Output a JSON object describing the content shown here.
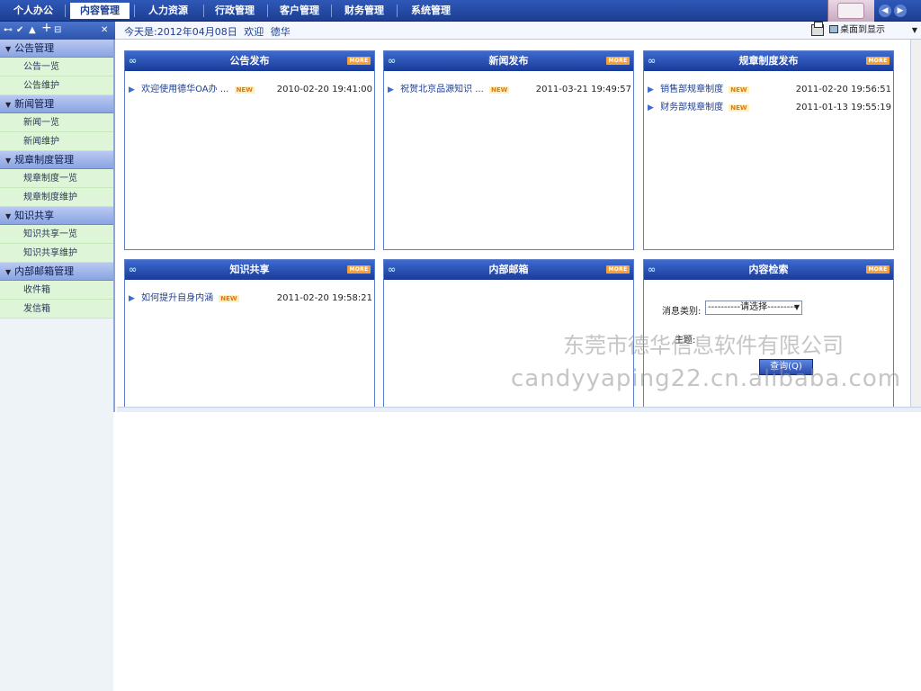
{
  "topnav": {
    "tabs": [
      {
        "label": "个人办公",
        "active": false
      },
      {
        "label": "内容管理",
        "active": true
      },
      {
        "label": "人力资源",
        "active": false
      },
      {
        "label": "行政管理",
        "active": false
      },
      {
        "label": "客户管理",
        "active": false
      },
      {
        "label": "财务管理",
        "active": false
      },
      {
        "label": "系统管理",
        "active": false
      }
    ]
  },
  "subbar": {
    "greeting_date": "今天是:2012年04月08日",
    "greeting_welcome": "欢迎",
    "greeting_user": "德华",
    "view_select": "桌面到显示"
  },
  "sidebar": {
    "groups": [
      {
        "label": "公告管理",
        "items": [
          "公告一览",
          "公告维护"
        ]
      },
      {
        "label": "新闻管理",
        "items": [
          "新闻一览",
          "新闻维护"
        ]
      },
      {
        "label": "规章制度管理",
        "items": [
          "规章制度一览",
          "规章制度维护"
        ]
      },
      {
        "label": "知识共享",
        "items": [
          "知识共享一览",
          "知识共享维护"
        ]
      },
      {
        "label": "内部邮箱管理",
        "items": [
          "收件箱",
          "发信箱"
        ]
      }
    ]
  },
  "panels": {
    "more_label": "MORE",
    "new_label": "NEW",
    "announcement": {
      "title": "公告发布",
      "rows": [
        {
          "title": "欢迎使用德华OA办 ...",
          "date": "2010-02-20 19:41:00"
        }
      ]
    },
    "news": {
      "title": "新闻发布",
      "rows": [
        {
          "title": "祝贺北京品源知识 ...",
          "date": "2011-03-21 19:49:57"
        }
      ]
    },
    "regulations": {
      "title": "规章制度发布",
      "rows": [
        {
          "title": "销售部规章制度",
          "date": "2011-02-20 19:56:51"
        },
        {
          "title": "财务部规章制度",
          "date": "2011-01-13 19:55:19"
        }
      ]
    },
    "knowledge": {
      "title": "知识共享",
      "rows": [
        {
          "title": "如何提升自身内涵",
          "date": "2011-02-20 19:58:21"
        }
      ]
    },
    "mailbox": {
      "title": "内部邮箱"
    },
    "search": {
      "title": "内容检索",
      "category_label": "消息类别:",
      "category_value": "----------请选择---------",
      "subject_label": "主题:",
      "query_button": "查询(Q)"
    }
  },
  "watermark": {
    "company": "东莞市德华信息软件有限公司",
    "site": "candyyaping22.cn.alibaba.com"
  },
  "colors": {
    "nav_blue": "#1d3e92",
    "panel_header": "#2a4fb0",
    "more_badge": "#f5a23a",
    "sidebar_item_bg": "#dff5d8"
  }
}
